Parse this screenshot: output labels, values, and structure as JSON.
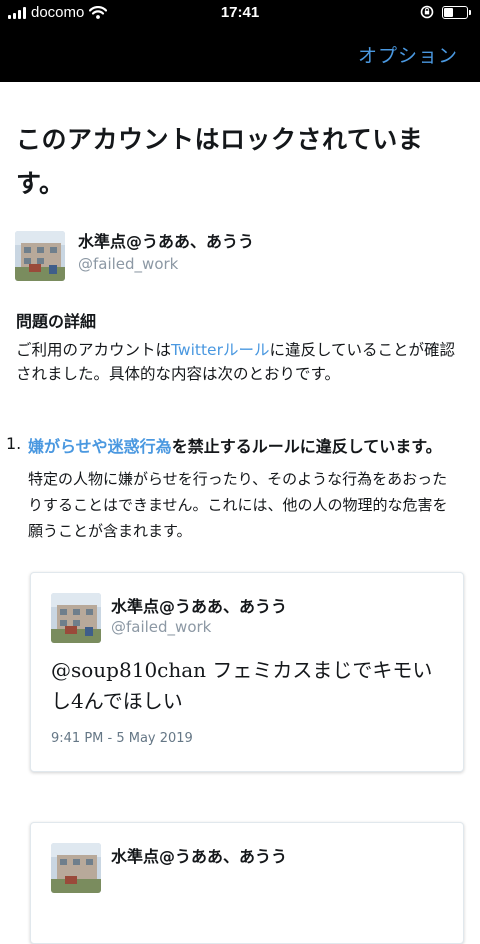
{
  "status_bar": {
    "carrier": "docomo",
    "time": "17:41",
    "battery_level": 0.45,
    "icons": [
      "signal-bars-icon",
      "wifi-icon",
      "orientation-lock-icon",
      "battery-icon"
    ]
  },
  "nav": {
    "options_label": "オプション"
  },
  "page": {
    "title": "このアカウントはロックされています。"
  },
  "account": {
    "name": "水準点@うああ、あうう",
    "handle": "@failed_work"
  },
  "details": {
    "heading": "問題の詳細",
    "body_prefix": "ご利用のアカウントは",
    "body_link": "Twitterルール",
    "body_suffix": "に違反していることが確認されました。具体的な内容は次のとおりです。"
  },
  "rule": {
    "number": "1.",
    "link": "嫌がらせや迷惑行為",
    "heading_suffix": "を禁止するルールに違反しています。",
    "description": "特定の人物に嫌がらせを行ったり、そのような行為をあおったりすることはできません。これには、他の人の物理的な危害を願うことが含まれます。"
  },
  "tweets": [
    {
      "name": "水準点@うああ、あうう",
      "handle": "@failed_work",
      "text": "@soup810chan フェミカスまじでキモいし4んでほしい",
      "date": "9:41 PM - 5 May 2019"
    },
    {
      "name": "水準点@うああ、あうう",
      "handle": "",
      "text": "",
      "date": ""
    }
  ],
  "colors": {
    "link": "#4a98e0",
    "status_bar_bg": "#000000",
    "muted_text": "#8c98a4"
  }
}
